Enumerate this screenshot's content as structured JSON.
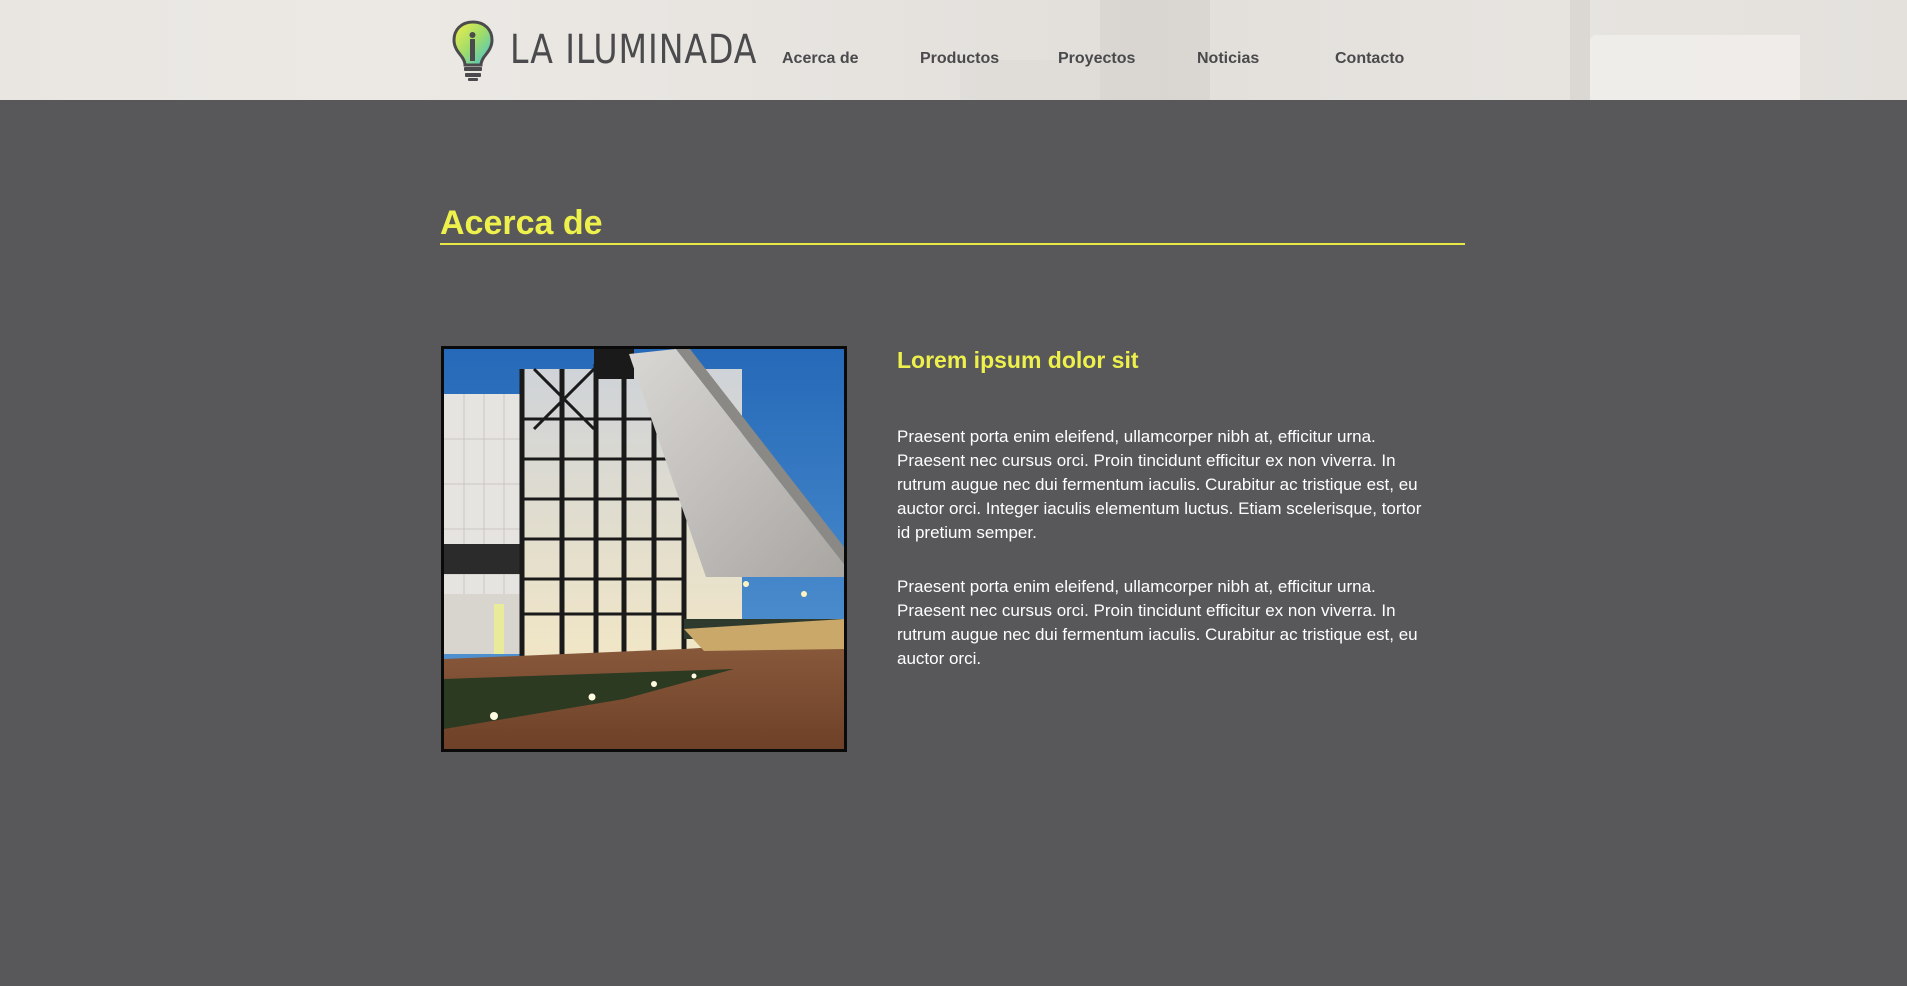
{
  "brand": {
    "name": "LA ILUMINADA"
  },
  "nav": {
    "items": [
      "Acerca de",
      "Productos",
      "Proyectos",
      "Noticias",
      "Contacto"
    ]
  },
  "section": {
    "title": "Acerca de"
  },
  "content": {
    "subtitle": "Lorem ipsum dolor sit",
    "paragraph_1": "Praesent porta enim eleifend, ullamcorper nibh at, efficitur urna. Praesent nec cursus orci. Proin tincidunt efficitur ex non viverra. In rutrum augue nec dui fermentum iaculis. Curabitur ac tristique est, eu auctor orci. Integer iaculis elementum luctus. Etiam scelerisque, tortor id pretium semper.",
    "paragraph_2": "Praesent porta enim eleifend, ullamcorper nibh at, efficitur urna. Praesent nec cursus orci. Proin tincidunt efficitur ex non viverra. In rutrum augue nec dui fermentum iaculis. Curabitur ac tristique est, eu auctor orci."
  },
  "colors": {
    "accent": "#eef04b",
    "background": "#58585a",
    "header_bg": "#e8e5e1",
    "nav_text": "#4a4a4c"
  },
  "icons": {
    "logo": "lightbulb-icon"
  }
}
